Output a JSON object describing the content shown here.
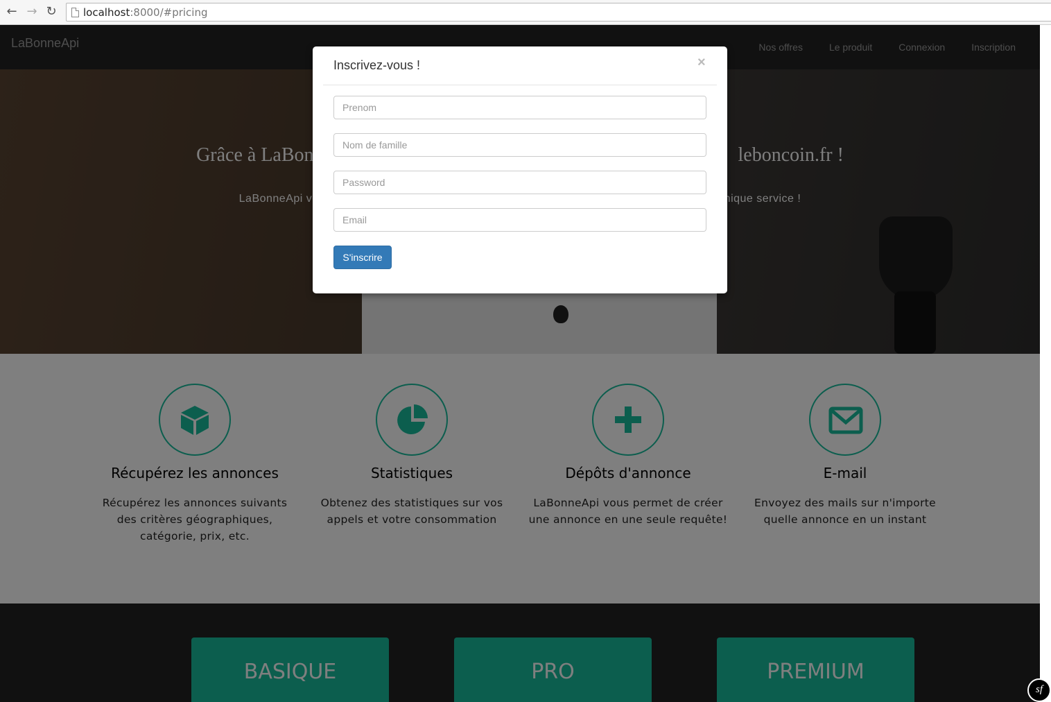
{
  "browser": {
    "url_host": "localhost",
    "url_rest": ":8000/#pricing",
    "back_icon": "arrow-left-icon",
    "forward_icon": "arrow-right-icon",
    "reload_icon": "reload-icon"
  },
  "navbar": {
    "brand": "LaBonneApi",
    "links": [
      "Nos offres",
      "Le produit",
      "Connexion",
      "Inscription"
    ]
  },
  "hero": {
    "title_left": "Grâce à LaBon",
    "title_right": "leboncoin.fr !",
    "sub_left": "LaBonneApi vo",
    "sub_right": "nique service !"
  },
  "features": [
    {
      "icon": "cube-icon",
      "title": "Récupérez les annonces",
      "desc": "Récupérez les annonces suivants des critères géographiques, catégorie, prix, etc."
    },
    {
      "icon": "pie-chart-icon",
      "title": "Statistiques",
      "desc": "Obtenez des statistiques sur vos appels et votre consommation"
    },
    {
      "icon": "plus-icon",
      "title": "Dépôts d'annonce",
      "desc": "LaBonneApi vous permet de créer une annonce en une seule requête!"
    },
    {
      "icon": "envelope-icon",
      "title": "E-mail",
      "desc": "Envoyez des mails sur n'importe quelle annonce en un instant"
    }
  ],
  "pricing": {
    "plans": [
      "BASIQUE",
      "PRO",
      "PREMIUM"
    ]
  },
  "modal": {
    "title": "Inscrivez-vous !",
    "close": "×",
    "fields": {
      "prenom": "Prenom",
      "nom": "Nom de famille",
      "password": "Password",
      "email": "Email"
    },
    "submit": "S'inscrire"
  },
  "symfony_badge": "sf",
  "colors": {
    "accent": "#18bc9c",
    "navbar": "#222222",
    "primary_button": "#337ab7"
  }
}
